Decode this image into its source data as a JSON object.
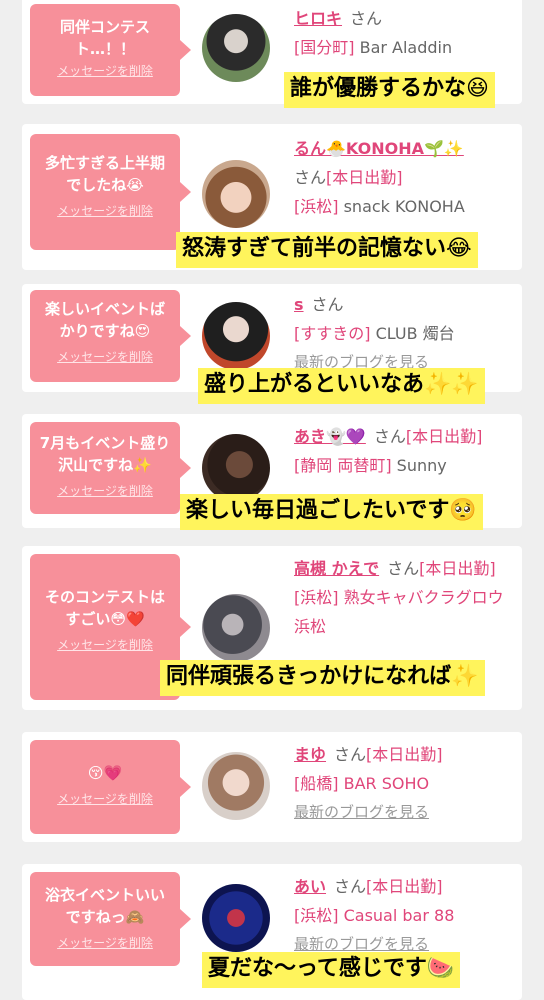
{
  "delete_label": "メッセージを削除",
  "blog_label": "最新のブログを見る",
  "entries": [
    {
      "message": "同伴コンテスト…！！",
      "name": "ヒロキ",
      "honorific": "さん",
      "status": "",
      "area": "[国分町]",
      "shop": "Bar Aladdin",
      "caption": "誰が優勝するかな😆"
    },
    {
      "message": "多忙すぎる上半期でしたね😭",
      "name": "るん🐣KONOHA🌱✨",
      "honorific": "さん",
      "status": "[本日出勤]",
      "area": "[浜松]",
      "shop": "snack KONOHA",
      "caption": "怒涛すぎて前半の記憶ない😂"
    },
    {
      "message": "楽しいイベントばかりですね😍",
      "name": "s",
      "honorific": "さん",
      "status": "",
      "area": "[すすきの]",
      "shop": "CLUB 燭台",
      "caption": "盛り上がるといいなあ✨✨"
    },
    {
      "message": "7月もイベント盛り沢山ですね✨",
      "name": "あき👻💜",
      "honorific": "さん",
      "status": "[本日出勤]",
      "area": "[静岡 両替町]",
      "shop": "Sunny",
      "caption": "楽しい毎日過ごしたいです🥺"
    },
    {
      "message": "そのコンテストはすごい😳❤️",
      "name": "高槻 かえで",
      "honorific": "さん",
      "status": "[本日出勤]",
      "area": "[浜松]",
      "shop": "熟女キャバクラグロウ 浜松",
      "caption": "同伴頑張るきっかけになれば✨"
    },
    {
      "message": "😚💗",
      "name": "まゆ",
      "honorific": "さん",
      "status": "[本日出勤]",
      "area": "[船橋]",
      "shop": "BAR SOHO",
      "caption": ""
    },
    {
      "message": "浴衣イベントいいですねっ🙈",
      "name": "あい",
      "honorific": "さん",
      "status": "[本日出勤]",
      "area": "[浜松]",
      "shop": "Casual bar 88",
      "caption": "夏だな〜って感じです🍉"
    }
  ]
}
